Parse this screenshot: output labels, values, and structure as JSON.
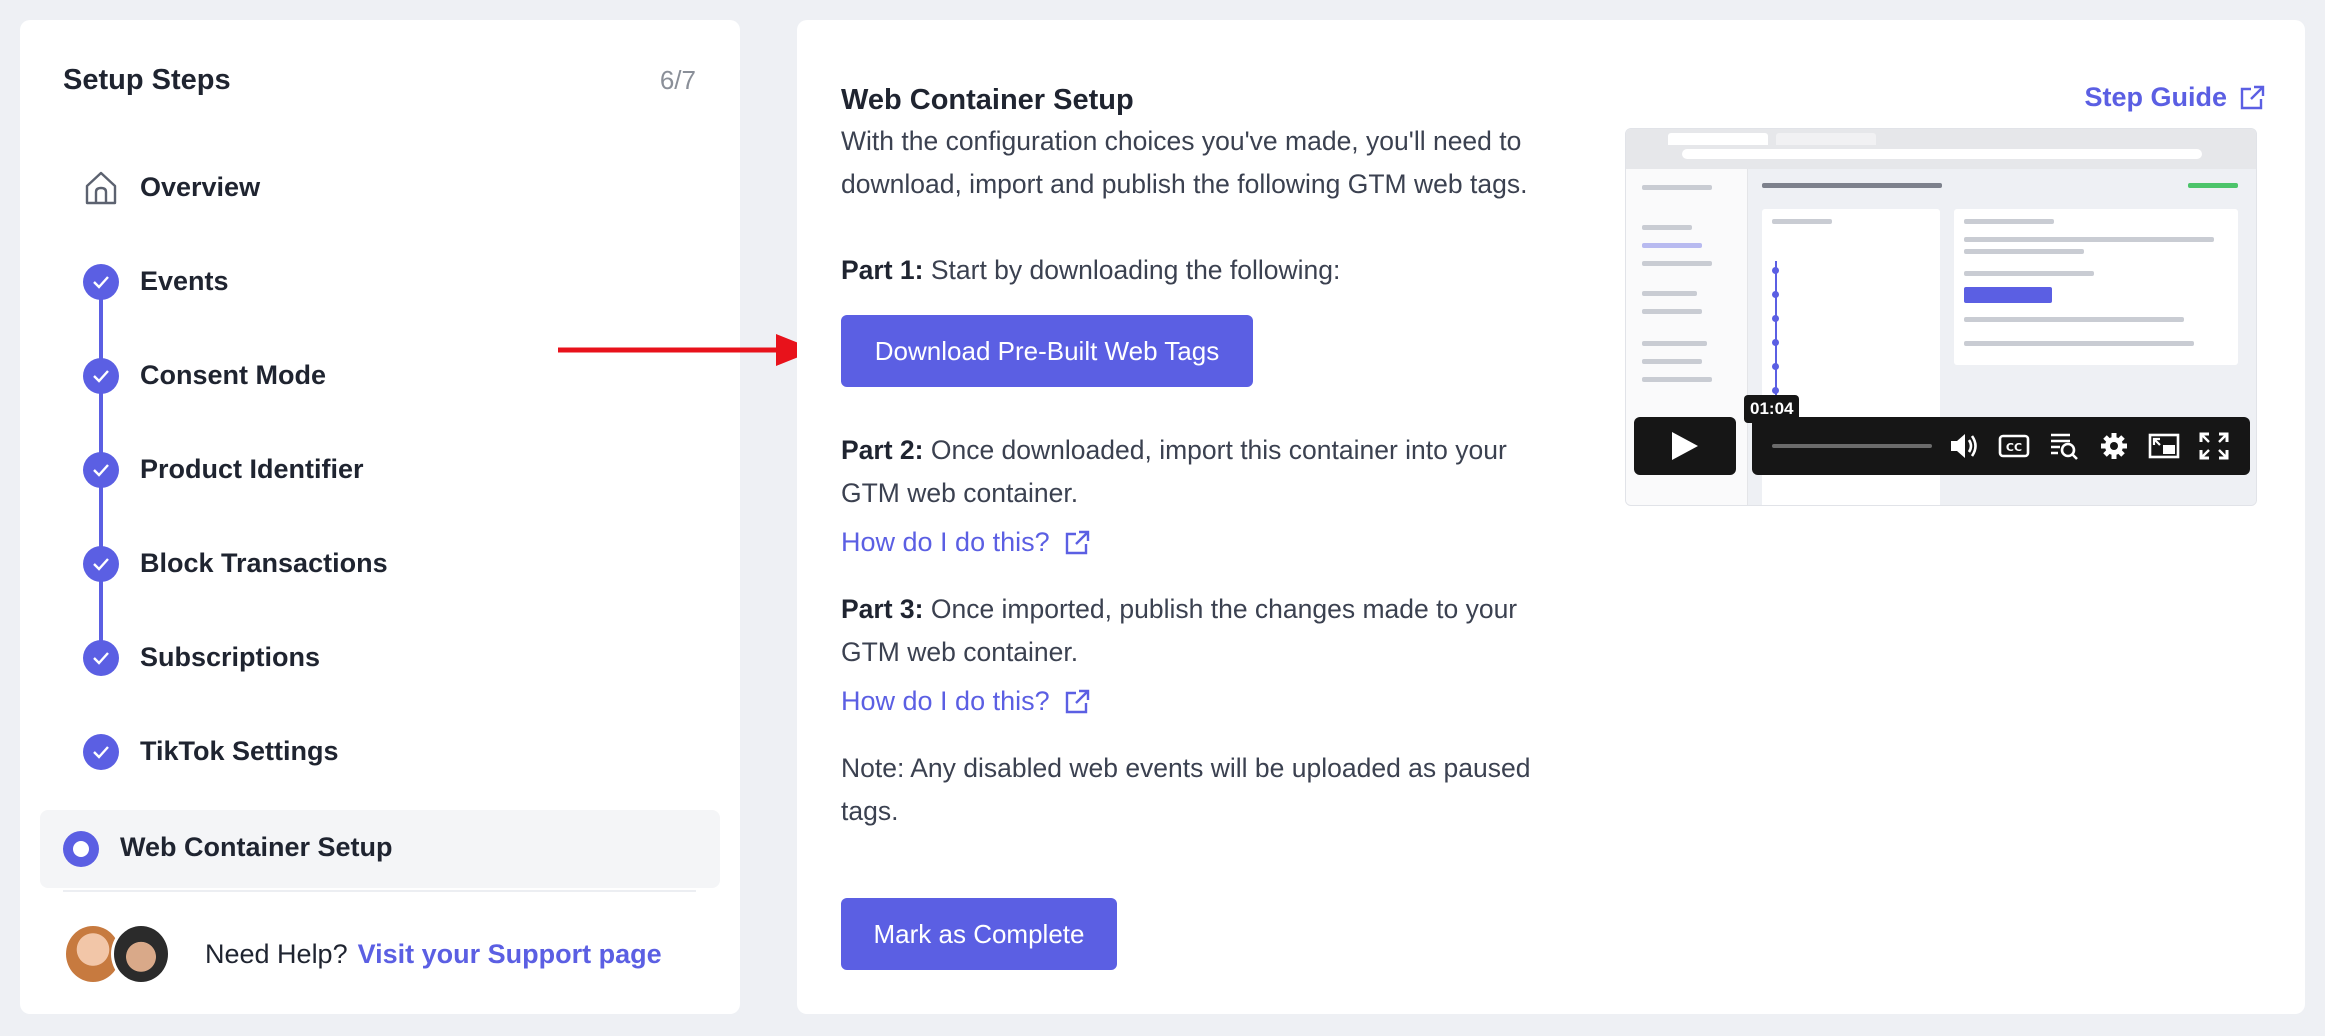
{
  "sidebar": {
    "title": "Setup Steps",
    "progress": "6/7",
    "steps": [
      {
        "label": "Overview",
        "state": "overview"
      },
      {
        "label": "Events",
        "state": "done"
      },
      {
        "label": "Consent Mode",
        "state": "done"
      },
      {
        "label": "Product Identifier",
        "state": "done"
      },
      {
        "label": "Block Transactions",
        "state": "done"
      },
      {
        "label": "Subscriptions",
        "state": "done"
      },
      {
        "label": "TikTok Settings",
        "state": "done"
      },
      {
        "label": "Web Container Setup",
        "state": "current"
      }
    ],
    "help": {
      "text": "Need Help?",
      "link": "Visit your Support page"
    }
  },
  "main": {
    "title": "Web Container Setup",
    "step_guide": "Step Guide",
    "intro": "With the configuration choices you've made, you'll need to download, import and publish the following GTM web tags.",
    "part1": {
      "label": "Part 1:",
      "text": " Start by downloading the following:"
    },
    "download_button": "Download Pre-Built Web Tags",
    "part2": {
      "label": "Part 2:",
      "text": " Once downloaded, import this container into your GTM web container."
    },
    "howto1": "How do I do this?",
    "part3": {
      "label": "Part 3:",
      "text": " Once imported, publish the changes made to your GTM web container."
    },
    "howto2": "How do I do this?",
    "note": "Note: Any disabled web events will be uploaded as paused tags.",
    "complete_button": "Mark as Complete",
    "video": {
      "time": "01:04"
    }
  },
  "colors": {
    "accent": "#5b5fe3",
    "arrow": "#e8121b",
    "background": "#eef0f4"
  }
}
